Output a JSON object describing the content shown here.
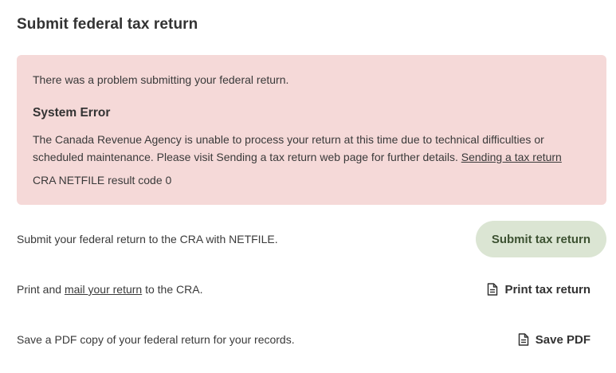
{
  "page": {
    "title": "Submit federal tax return"
  },
  "error": {
    "intro": "There was a problem submitting your federal return.",
    "heading": "System Error",
    "message": "The Canada Revenue Agency is unable to process your return at this time due to technical difficulties or scheduled maintenance. Please visit Sending a tax return web page for further details.",
    "link_label": "Sending a tax return",
    "result_code": "CRA NETFILE result code 0",
    "background_color": "#f5d9d8"
  },
  "submit": {
    "description": "Submit your federal return to the CRA with NETFILE.",
    "button_label": "Submit tax return",
    "button_color": "#dbe5d3"
  },
  "print": {
    "description_prefix": "Print and",
    "link_label": "mail your return",
    "description_suffix": "to the CRA.",
    "button_label": "Print tax return",
    "icon": "document-icon"
  },
  "save": {
    "description": "Save a PDF copy of your federal return for your records.",
    "button_label": "Save PDF",
    "icon": "document-icon"
  }
}
